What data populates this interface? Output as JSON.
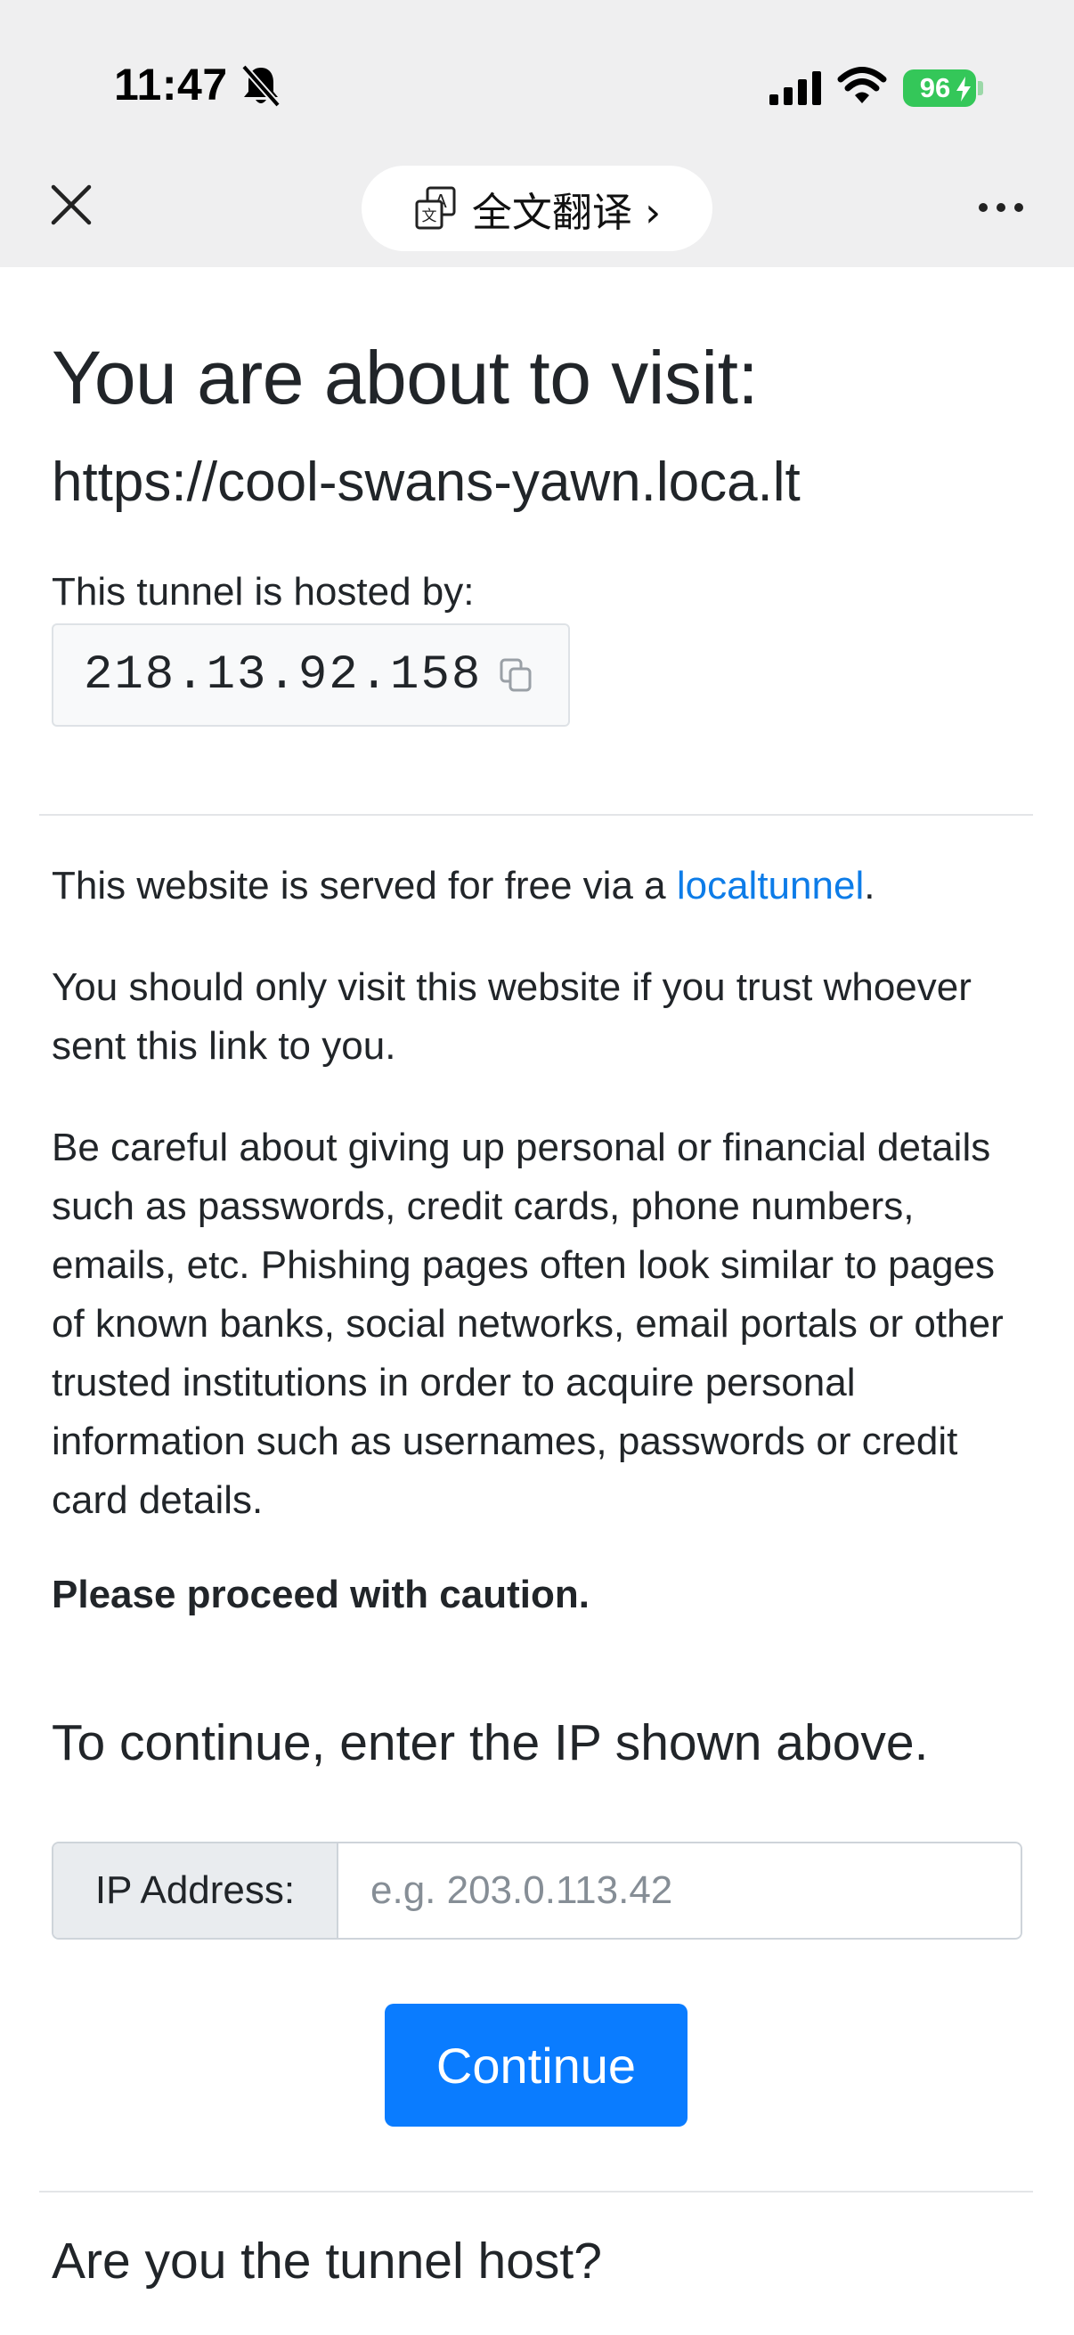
{
  "status_bar": {
    "time": "11:47",
    "battery": "96"
  },
  "top_bar": {
    "translate_label": "全文翻译 ›"
  },
  "page": {
    "heading": "You are about to visit:",
    "url": "https://cool-swans-yawn.loca.lt",
    "hosted_label": "This tunnel is hosted by:",
    "host_ip": "218.13.92.158",
    "served_text_prefix": "This website is served for free via a ",
    "served_link": "localtunnel",
    "served_text_suffix": ".",
    "trust_text": "You should only visit this website if you trust whoever sent this link to you.",
    "careful_text": "Be careful about giving up personal or financial details such as passwords, credit cards, phone numbers, emails, etc. Phishing pages often look similar to pages of known banks, social networks, email portals or other trusted institutions in order to acquire personal information such as usernames, passwords or credit card details.",
    "caution_text": "Please proceed with caution.",
    "continue_heading": "To continue, enter the IP shown above.",
    "input_label": "IP Address:",
    "input_placeholder": "e.g. 203.0.113.42",
    "input_value": "",
    "continue_label": "Continue",
    "host_heading": "Are you the tunnel host?"
  },
  "colors": {
    "link": "#0d7ce8",
    "button": "#0a7cff",
    "battery": "#34c759",
    "chrome": "#efeff0"
  }
}
